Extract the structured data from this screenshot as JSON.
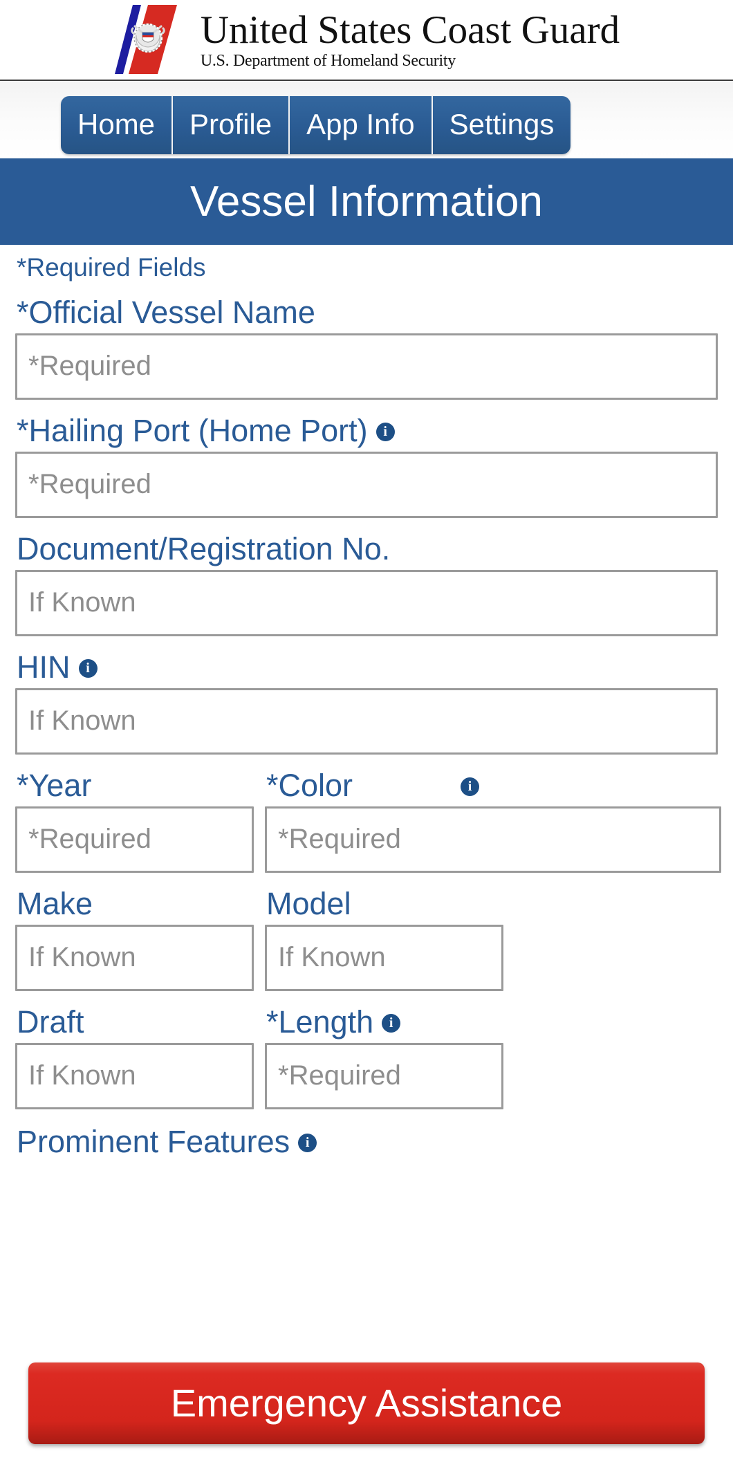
{
  "brand": {
    "agency_name": "United States Coast Guard",
    "department": "U.S. Department of Homeland Security",
    "logo_icon": "uscg-racing-stripe-emblem-icon",
    "colors": {
      "stripe_red": "#D62A22",
      "stripe_blue": "#1D1DA0",
      "header_blue": "#2A5B96"
    }
  },
  "nav": {
    "items": [
      {
        "label": "Home",
        "name": "home"
      },
      {
        "label": "Profile",
        "name": "profile"
      },
      {
        "label": "App Info",
        "name": "app-info"
      },
      {
        "label": "Settings",
        "name": "settings"
      }
    ]
  },
  "page": {
    "title": "Vessel Information",
    "required_note": "*Required Fields"
  },
  "form": {
    "vessel_name": {
      "label": "*Official Vessel Name",
      "placeholder": "*Required",
      "value": "",
      "has_info": false
    },
    "hailing_port": {
      "label": "*Hailing Port (Home Port)",
      "placeholder": "*Required",
      "value": "",
      "has_info": true,
      "info_icon": "info-icon"
    },
    "document_no": {
      "label": "Document/Registration No.",
      "placeholder": "If Known",
      "value": "",
      "has_info": false
    },
    "hin": {
      "label": "HIN",
      "placeholder": "If Known",
      "value": "",
      "has_info": true,
      "info_icon": "info-icon"
    },
    "year": {
      "label": "*Year",
      "placeholder": "*Required",
      "value": "",
      "has_info": false
    },
    "color": {
      "label": "*Color",
      "placeholder": "*Required",
      "value": "",
      "has_info": true,
      "info_icon": "info-icon"
    },
    "make": {
      "label": "Make",
      "placeholder": "If Known",
      "value": "",
      "has_info": false
    },
    "model": {
      "label": "Model",
      "placeholder": "If Known",
      "value": "",
      "has_info": false
    },
    "draft": {
      "label": "Draft",
      "placeholder": "If Known",
      "value": "",
      "has_info": false
    },
    "length": {
      "label": "*Length",
      "placeholder": "*Required",
      "value": "",
      "has_info": true,
      "info_icon": "info-icon"
    },
    "prominent_features": {
      "label": "Prominent Features",
      "has_info": true,
      "info_icon": "info-icon"
    }
  },
  "emergency": {
    "label": "Emergency Assistance",
    "color": "#DC2A22"
  },
  "icons": {
    "info": "i"
  }
}
